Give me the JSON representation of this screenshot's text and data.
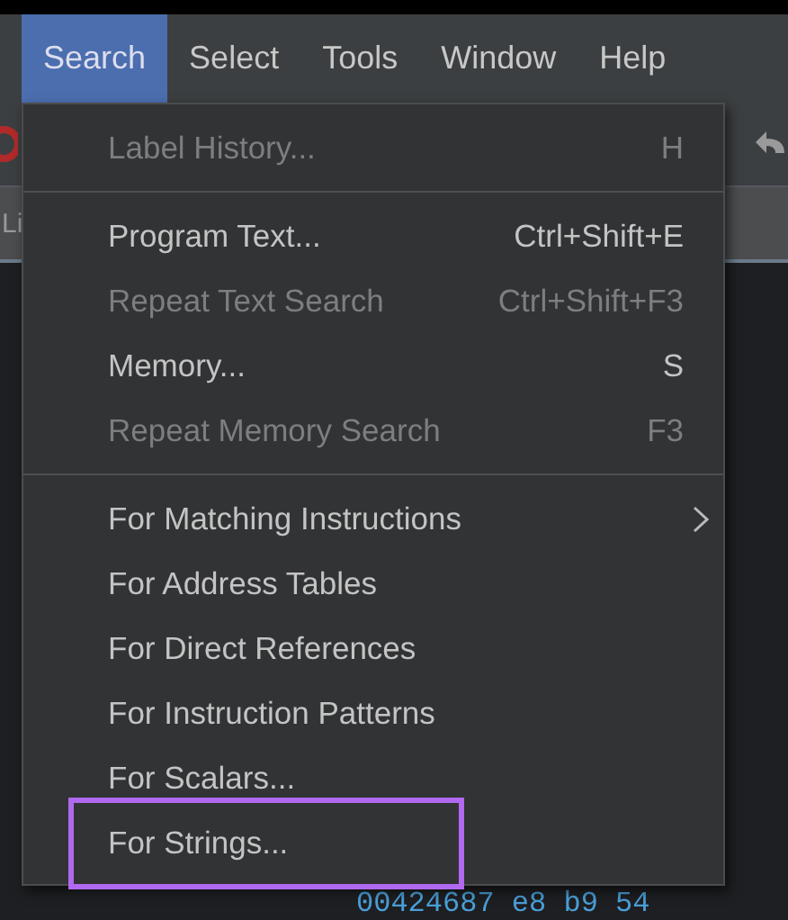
{
  "menubar": [
    {
      "label": "Search",
      "selected": true
    },
    {
      "label": "Select",
      "selected": false
    },
    {
      "label": "Tools",
      "selected": false
    },
    {
      "label": "Window",
      "selected": false
    },
    {
      "label": "Help",
      "selected": false
    }
  ],
  "tab_strip": {
    "label": "Li"
  },
  "menu": {
    "sections": [
      [
        {
          "label": "Label History...",
          "shortcut": "H",
          "disabled": true,
          "submenu": false,
          "highlighted": false
        }
      ],
      [
        {
          "label": "Program Text...",
          "shortcut": "Ctrl+Shift+E",
          "disabled": false,
          "submenu": false,
          "highlighted": false
        },
        {
          "label": "Repeat Text Search",
          "shortcut": "Ctrl+Shift+F3",
          "disabled": true,
          "submenu": false,
          "highlighted": false
        },
        {
          "label": "Memory...",
          "shortcut": "S",
          "disabled": false,
          "submenu": false,
          "highlighted": false
        },
        {
          "label": "Repeat Memory Search",
          "shortcut": "F3",
          "disabled": true,
          "submenu": false,
          "highlighted": false
        }
      ],
      [
        {
          "label": "For Matching Instructions",
          "disabled": false,
          "submenu": true,
          "highlighted": false
        },
        {
          "label": "For Address Tables",
          "disabled": false,
          "submenu": false,
          "highlighted": false
        },
        {
          "label": "For Direct References",
          "disabled": false,
          "submenu": false,
          "highlighted": false
        },
        {
          "label": "For Instruction Patterns",
          "disabled": false,
          "submenu": false,
          "highlighted": false
        },
        {
          "label": "For Scalars...",
          "disabled": false,
          "submenu": false,
          "highlighted": false
        },
        {
          "label": "For Strings...",
          "disabled": false,
          "submenu": false,
          "highlighted": true
        }
      ]
    ]
  },
  "listing_line": "00424687 e8 b9 54"
}
